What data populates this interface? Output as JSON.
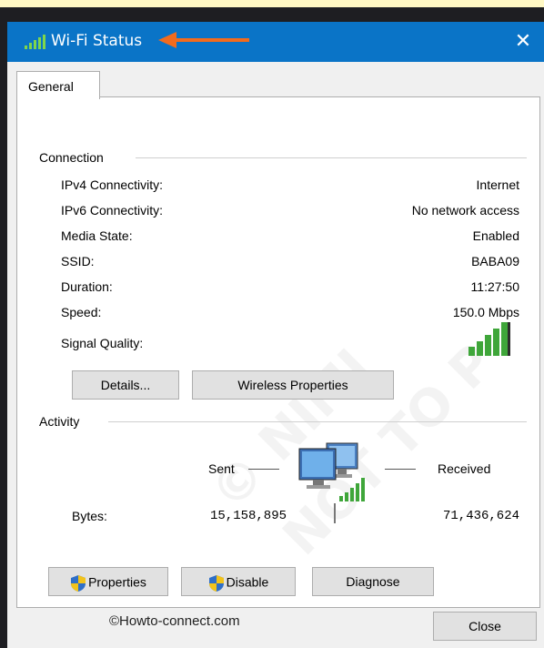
{
  "window": {
    "title": "Wi-Fi Status",
    "close_glyph": "✕",
    "title_icon": "signal-bars-icon",
    "annotation_color": "#f26b1d",
    "titlebar_color": "#0a74c7"
  },
  "tabs": [
    {
      "label": "General",
      "selected": true
    }
  ],
  "connection": {
    "label": "Connection",
    "rows": [
      {
        "label": "IPv4 Connectivity:",
        "value": "Internet"
      },
      {
        "label": "IPv6 Connectivity:",
        "value": "No network access"
      },
      {
        "label": "Media State:",
        "value": "Enabled"
      },
      {
        "label": "SSID:",
        "value": "BABA09"
      },
      {
        "label": "Duration:",
        "value": "11:27:50"
      },
      {
        "label": "Speed:",
        "value": "150.0 Mbps"
      }
    ],
    "signal_label": "Signal Quality:",
    "signal_bars_lit": 5,
    "signal_bars_total": 5,
    "details_button": "Details...",
    "wireless_button": "Wireless Properties"
  },
  "activity": {
    "label": "Activity",
    "sent_label": "Sent",
    "received_label": "Received",
    "bytes_label": "Bytes:",
    "bytes_sent": "15,158,895",
    "bytes_received": "71,436,624",
    "network_icon": "network-computers-icon"
  },
  "buttons": {
    "properties": "Properties",
    "disable": "Disable",
    "diagnose": "Diagnose",
    "close": "Close"
  },
  "footer": {
    "text": "©Howto-connect.com"
  },
  "watermark": {
    "line1": "© NIMI",
    "line2": "NOT TO P"
  }
}
